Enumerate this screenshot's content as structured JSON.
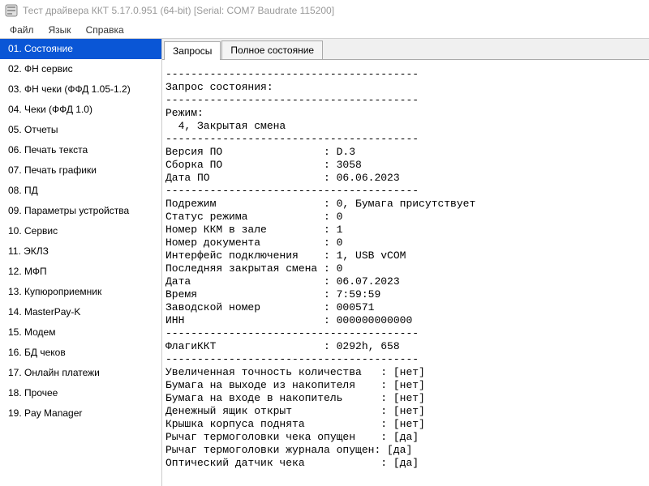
{
  "window": {
    "title": "Тест драйвера ККТ 5.17.0.951 (64-bit) [Serial: COM7 Baudrate 115200]"
  },
  "menu": {
    "items": [
      "Файл",
      "Язык",
      "Справка"
    ]
  },
  "sidebar": {
    "items": [
      "01. Состояние",
      "02. ФН сервис",
      "03. ФН чеки (ФФД 1.05-1.2)",
      "04. Чеки (ФФД 1.0)",
      "05. Отчеты",
      "06. Печать текста",
      "07. Печать графики",
      "08. ПД",
      "09. Параметры устройства",
      "10. Сервис",
      "11. ЭКЛЗ",
      "12. МФП",
      "13. Купюроприемник",
      "14. MasterPay-K",
      "15. Модем",
      "16. БД чеков",
      "17. Онлайн платежи",
      "18. Прочее",
      "19. Pay Manager"
    ],
    "selected": 0
  },
  "tabs": {
    "items": [
      "Запросы",
      "Полное состояние"
    ],
    "active": 0
  },
  "output": "----------------------------------------\nЗапрос состояния:\n----------------------------------------\nРежим:\n  4, Закрытая смена\n----------------------------------------\nВерсия ПО                : D.3\nСборка ПО                : 3058\nДата ПО                  : 06.06.2023\n----------------------------------------\nПодрежим                 : 0, Бумага присутствует\nСтатус режима            : 0\nНомер ККМ в зале         : 1\nНомер документа          : 0\nИнтерфейс подключения    : 1, USB vCOM\nПоследняя закрытая смена : 0\nДата                     : 06.07.2023\nВремя                    : 7:59:59\nЗаводской номер          : 000571\nИНН                      : 000000000000\n----------------------------------------\nФлагиККТ                 : 0292h, 658\n----------------------------------------\nУвеличенная точность количества   : [нет]\nБумага на выходе из накопителя    : [нет]\nБумага на входе в накопитель      : [нет]\nДенежный ящик открыт              : [нет]\nКрышка корпуса поднята            : [нет]\nРычаг термоголовки чека опущен    : [да]\nРычаг термоголовки журнала опущен: [да]\nОптический датчик чека            : [да]"
}
